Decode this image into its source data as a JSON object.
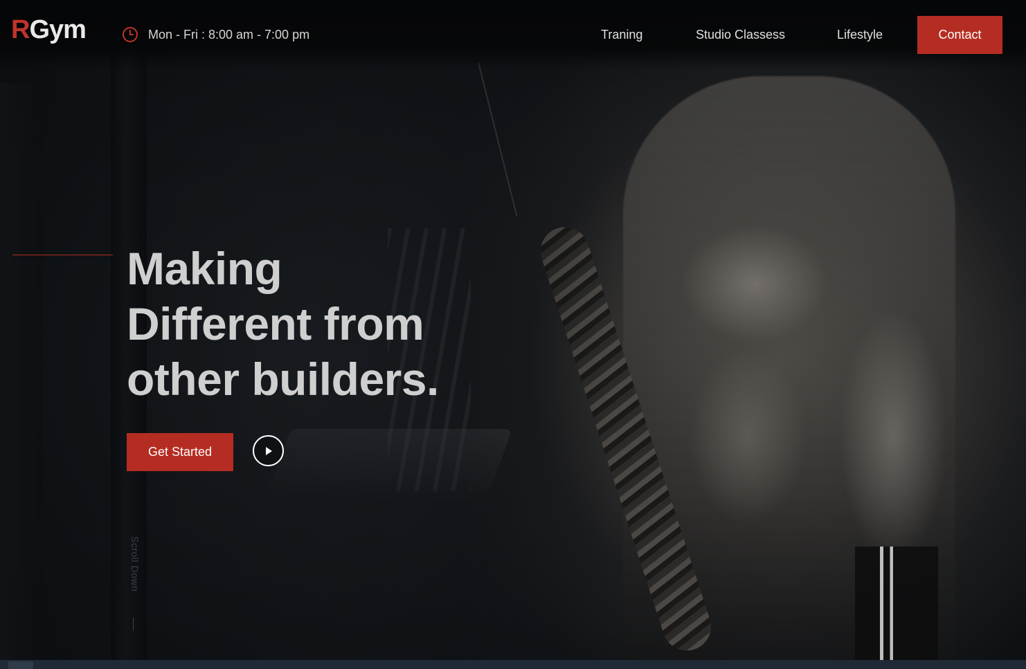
{
  "brand": {
    "logo_accent": "R",
    "logo_rest": "Gym",
    "accent_color": "#b52d22"
  },
  "header": {
    "hours_icon": "clock-icon",
    "hours": "Mon - Fri : 8:00 am - 7:00 pm",
    "nav": [
      "Traning",
      "Studio Classess",
      "Lifestyle"
    ],
    "contact_label": "Contact"
  },
  "hero": {
    "headline": [
      "Making",
      "Different from",
      "other builders."
    ],
    "cta_label": "Get Started",
    "play_icon": "play-icon",
    "scroll_label": "Scroll Down"
  }
}
